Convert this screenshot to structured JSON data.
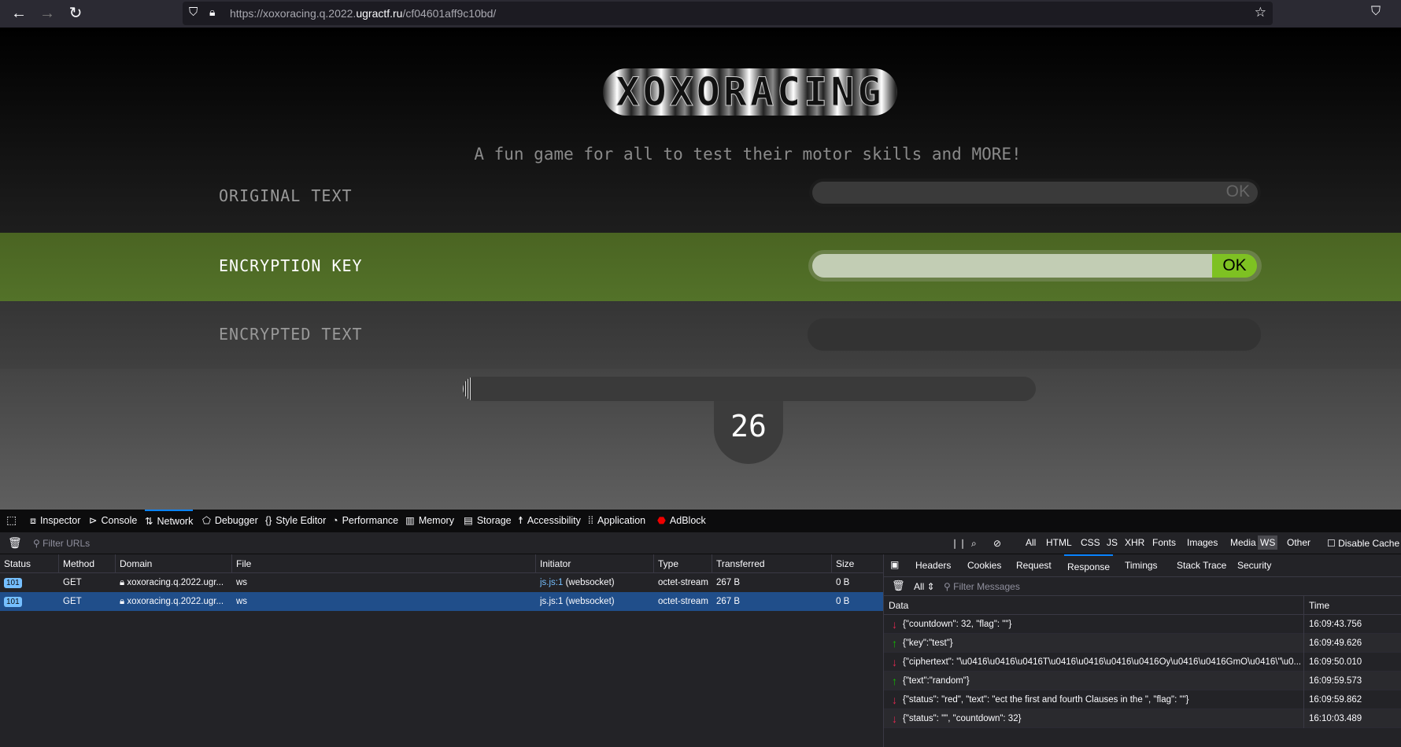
{
  "browser": {
    "url_prefix": "https://xoxoracing.q.2022.",
    "url_domain": "ugractf.ru",
    "url_path": "/cf04601aff9c10bd/"
  },
  "game": {
    "logo": "XOXORACING",
    "subtitle": "A fun game for all to test their motor skills and MORE!",
    "rows": [
      {
        "label": "ORIGINAL TEXT",
        "value": "",
        "button": "OK",
        "state": "inactive"
      },
      {
        "label": "ENCRYPTION KEY",
        "value": "",
        "button": "OK",
        "state": "active"
      },
      {
        "label": "ENCRYPTED TEXT",
        "value": "",
        "state": "inactive"
      }
    ],
    "progress": 0.01,
    "countdown": "26",
    "colors": {
      "active_band": "#4b6624",
      "ok_button": "#7ec122"
    }
  },
  "devtools": {
    "tabs": [
      "Inspector",
      "Console",
      "Network",
      "Debugger",
      "Style Editor",
      "Performance",
      "Memory",
      "Storage",
      "Accessibility",
      "Application",
      "AdBlock"
    ],
    "active_tab": "Network",
    "filter_placeholder": "Filter URLs",
    "type_filters": [
      "All",
      "HTML",
      "CSS",
      "JS",
      "XHR",
      "Fonts",
      "Images",
      "Media",
      "WS",
      "Other"
    ],
    "active_filter": "WS",
    "disable_cache": "Disable Cache",
    "columns": [
      "Status",
      "Method",
      "Domain",
      "File",
      "Initiator",
      "Type",
      "Transferred",
      "Size"
    ],
    "requests": [
      {
        "status": "101",
        "method": "GET",
        "domain": "xoxoracing.q.2022.ugr...",
        "file": "ws",
        "initiator_link": "js.js:1",
        "initiator_rest": " (websocket)",
        "type": "octet-stream",
        "transferred": "267 B",
        "size": "0 B"
      },
      {
        "status": "101",
        "method": "GET",
        "domain": "xoxoracing.q.2022.ugr...",
        "file": "ws",
        "initiator_link": "js.js:1",
        "initiator_rest": " (websocket)",
        "type": "octet-stream",
        "transferred": "267 B",
        "size": "0 B"
      }
    ],
    "detail_tabs": [
      "Headers",
      "Cookies",
      "Request",
      "Response",
      "Timings",
      "Stack Trace",
      "Security"
    ],
    "active_detail_tab": "Response",
    "msg_filter_select": "All",
    "msg_filter_placeholder": "Filter Messages",
    "msg_columns": [
      "Data",
      "Time"
    ],
    "messages": [
      {
        "dir": "in",
        "data": "{\"countdown\": 32, \"flag\": \"\"}",
        "time": "16:09:43.756"
      },
      {
        "dir": "out",
        "data": "{\"key\":\"test\"}",
        "time": "16:09:49.626"
      },
      {
        "dir": "in",
        "data": "{\"ciphertext\": \"\\u0416\\u0416\\u0416T\\u0416\\u0416\\u0416\\u0416Oy\\u0416\\u0416GmO\\u0416\\\"\\u0...",
        "time": "16:09:50.010"
      },
      {
        "dir": "out",
        "data": "{\"text\":\"random\"}",
        "time": "16:09:59.573"
      },
      {
        "dir": "in",
        "data": "{\"status\": \"red\", \"text\": \"ect the first and fourth Clauses in the \", \"flag\": \"\"}",
        "time": "16:09:59.862"
      },
      {
        "dir": "in",
        "data": "{\"status\": \"\", \"countdown\": 32}",
        "time": "16:10:03.489"
      }
    ]
  }
}
